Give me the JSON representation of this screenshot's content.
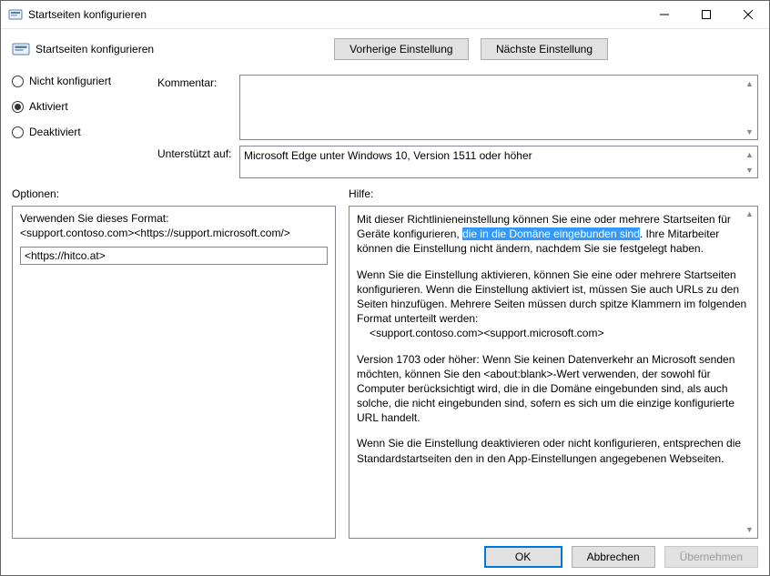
{
  "window": {
    "title": "Startseiten konfigurieren"
  },
  "header": {
    "title": "Startseiten konfigurieren",
    "prev": "Vorherige Einstellung",
    "next": "Nächste Einstellung"
  },
  "radios": {
    "not_configured": "Nicht konfiguriert",
    "enabled": "Aktiviert",
    "disabled": "Deaktiviert",
    "selected": "enabled"
  },
  "labels": {
    "comment": "Kommentar:",
    "supported": "Unterstützt auf:",
    "options": "Optionen:",
    "help": "Hilfe:"
  },
  "comment_value": "",
  "supported_value": "Microsoft Edge unter Windows 10, Version 1511 oder höher",
  "options_panel": {
    "label": "Verwenden Sie dieses Format:",
    "hint": "<support.contoso.com><https://support.microsoft.com/>",
    "value": "<https://hitco.at>"
  },
  "help_panel": {
    "p1_pre": "Mit dieser Richtlinieneinstellung können Sie eine oder mehrere Startseiten für Geräte konfigurieren, ",
    "p1_hl": "die in die Domäne eingebunden sind",
    "p1_post": ". Ihre Mitarbeiter können die Einstellung nicht ändern, nachdem Sie sie festgelegt haben.",
    "p2": "Wenn Sie die Einstellung aktivieren, können Sie eine oder mehrere Startseiten konfigurieren. Wenn die Einstellung aktiviert ist, müssen Sie auch URLs zu den Seiten hinzufügen. Mehrere Seiten müssen durch spitze Klammern im folgenden Format unterteilt werden:",
    "p2_indent": "<support.contoso.com><support.microsoft.com>",
    "p3": "Version 1703 oder höher: Wenn Sie keinen Datenverkehr an Microsoft senden möchten, können Sie den <about:blank>-Wert verwenden, der sowohl für Computer berücksichtigt wird, die in die Domäne eingebunden sind, als auch solche, die nicht eingebunden sind, sofern es sich um die einzige konfigurierte URL handelt.",
    "p4": "Wenn Sie die Einstellung deaktivieren oder nicht konfigurieren, entsprechen die Standardstartseiten den in den App-Einstellungen angegebenen Webseiten."
  },
  "footer": {
    "ok": "OK",
    "cancel": "Abbrechen",
    "apply": "Übernehmen"
  }
}
